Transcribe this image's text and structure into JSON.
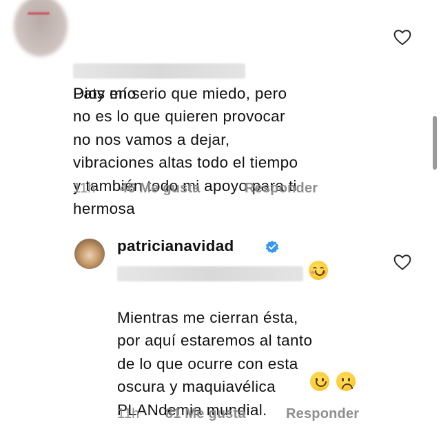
{
  "comments": [
    {
      "text_first": "Dios mío",
      "text_rest": "Paty en serio que miedo, pero\nno es lo que quieren provocar\nno nos vamos a dejar,\nvibraciones altas todo el tiempo\ny también todo mi apoyo para ti\nhermosa",
      "time": "11h",
      "likes": "46 Me gusta",
      "reply": "Responder",
      "heart_icon": "heart-outline-icon"
    },
    {
      "username": "patricianavidad",
      "verified_icon": "verified-badge-icon",
      "text": "Mientras me cierran ésta,\npor aquí estaremos al tanto\nde lo que ocurre con esta\noscura y maquiavélica\nPLANdemia mundial.",
      "time": "11h",
      "likes": "81 Me gusta",
      "reply": "Responder",
      "heart_icon": "heart-outline-icon"
    }
  ],
  "colors": {
    "meta": "#8e8e8e",
    "verified": "#3897f0",
    "text": "#111111"
  }
}
